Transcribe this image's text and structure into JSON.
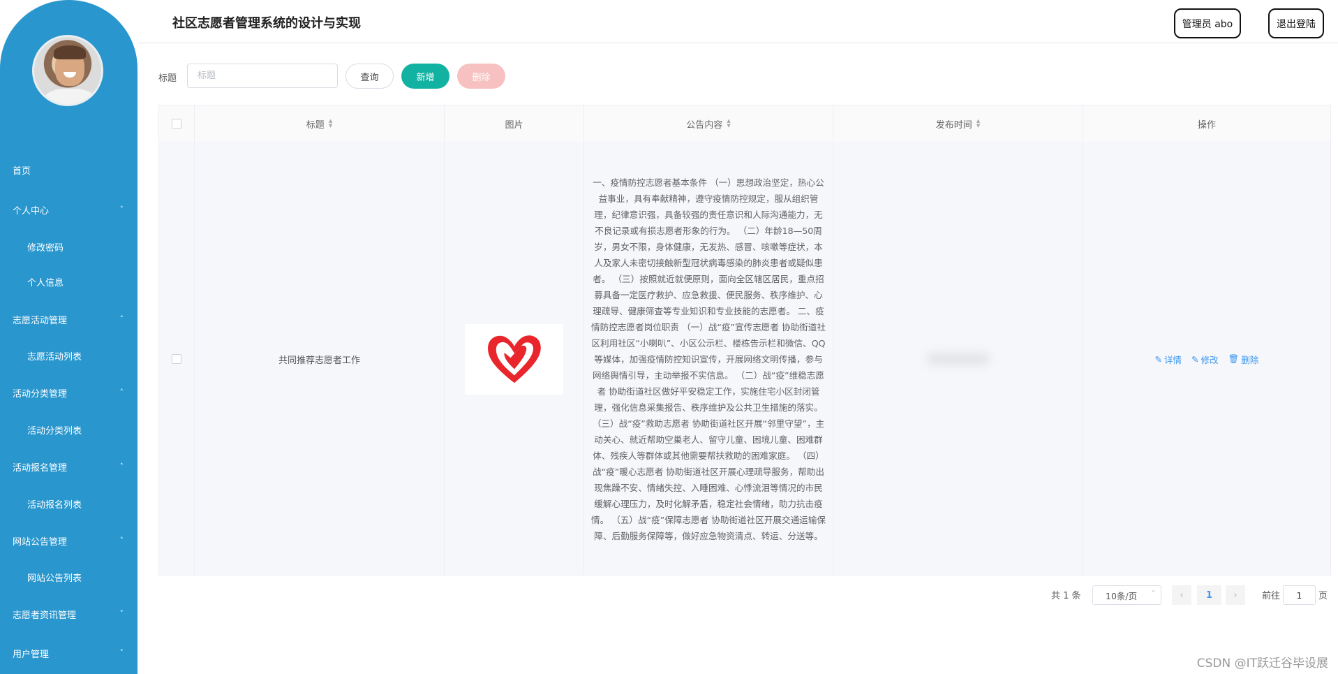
{
  "header": {
    "title": "社区志愿者管理系统的设计与实现",
    "admin_label": "管理员 abo",
    "logout_label": "退出登陆"
  },
  "sidebar": {
    "items": [
      {
        "label": "首页",
        "type": "item"
      },
      {
        "label": "个人中心",
        "type": "group",
        "expanded": true
      },
      {
        "label": "修改密码",
        "type": "sub"
      },
      {
        "label": "个人信息",
        "type": "sub"
      },
      {
        "label": "志愿活动管理",
        "type": "group",
        "expanded": true
      },
      {
        "label": "志愿活动列表",
        "type": "sub"
      },
      {
        "label": "活动分类管理",
        "type": "group",
        "expanded": true
      },
      {
        "label": "活动分类列表",
        "type": "sub"
      },
      {
        "label": "活动报名管理",
        "type": "group",
        "expanded": true
      },
      {
        "label": "活动报名列表",
        "type": "sub"
      },
      {
        "label": "网站公告管理",
        "type": "group",
        "expanded": true
      },
      {
        "label": "网站公告列表",
        "type": "sub"
      },
      {
        "label": "志愿者资讯管理",
        "type": "group",
        "expanded": false
      },
      {
        "label": "用户管理",
        "type": "group",
        "expanded": false
      }
    ],
    "chevron_up": "˄",
    "chevron_down": "˅"
  },
  "toolbar": {
    "title_label": "标题",
    "search_placeholder": "标题",
    "query_label": "查询",
    "add_label": "新增",
    "delete_label": "删除"
  },
  "table": {
    "headers": {
      "title": "标题",
      "image": "图片",
      "content": "公告内容",
      "publish_time": "发布时间",
      "actions": "操作"
    },
    "rows": [
      {
        "title": "共同推荐志愿者工作",
        "content": "一、疫情防控志愿者基本条件 （一）思想政治坚定，热心公益事业，具有奉献精神，遵守疫情防控规定，服从组织管理，纪律意识强，具备较强的责任意识和人际沟通能力，无不良记录或有损志愿者形象的行为。 （二）年龄18—50周岁，男女不限，身体健康，无发热、感冒、咳嗽等症状，本人及家人未密切接触新型冠状病毒感染的肺炎患者或疑似患者。 （三）按照就近就便原则，面向全区辖区居民，重点招募具备一定医疗救护、应急救援、便民服务、秩序维护、心理疏导、健康筛查等专业知识和专业技能的志愿者。 二、疫情防控志愿者岗位职责 （一）战“疫”宣传志愿者 协助街道社区利用社区“小喇叭”、小区公示栏、楼栋告示栏和微信、QQ等媒体，加强疫情防控知识宣传，开展网络文明传播，参与网络舆情引导，主动举报不实信息。 （二）战“疫”维稳志愿者 协助街道社区做好平安稳定工作，实施住宅小区封闭管理，强化信息采集报告、秩序维护及公共卫生措施的落实。 （三）战“疫”救助志愿者 协助街道社区开展“邻里守望”，主动关心、就近帮助空巢老人、留守儿童、困境儿童、困难群体、残疾人等群体或其他需要帮扶救助的困难家庭。 （四）战“疫”暖心志愿者 协助街道社区开展心理疏导服务，帮助出现焦躁不安、情绪失控、入睡困难、心悸流泪等情况的市民缓解心理压力，及时化解矛盾，稳定社会情绪，助力抗击疫情。 （五）战“疫”保障志愿者 协助街道社区开展交通运输保障、后勤服务保障等，做好应急物资清点、转运、分送等。",
        "image_icon": "heart-hand-logo-icon",
        "actions": {
          "detail": "详情",
          "edit": "修改",
          "delete": "删除"
        }
      }
    ]
  },
  "pagination": {
    "total_text": "共 1 条",
    "page_size": "10条/页",
    "prev": "‹",
    "current_page": "1",
    "next": "›",
    "goto_label": "前往",
    "goto_value": "1",
    "page_suffix": "页"
  },
  "watermark": "CSDN @IT跃迁谷毕设展",
  "colors": {
    "sidebar": "#2a96ce",
    "add_button": "#12b2a3",
    "delete_button": "#f7c0c1",
    "link": "#3d97f0",
    "logo_red": "#e8262b"
  }
}
